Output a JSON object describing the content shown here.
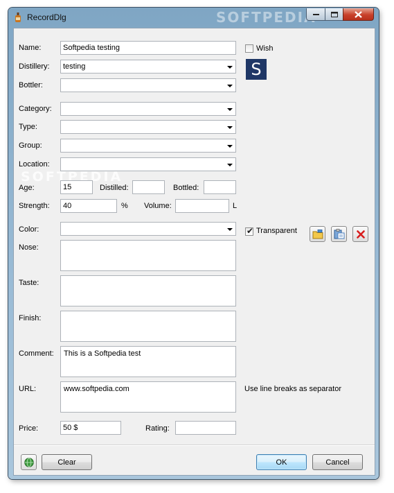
{
  "window": {
    "title": "RecordDlg"
  },
  "watermark": "SOFTPEDIA",
  "fields": {
    "name": {
      "label": "Name:",
      "value": "Softpedia testing"
    },
    "distillery": {
      "label": "Distillery:",
      "value": "testing"
    },
    "bottler": {
      "label": "Bottler:",
      "value": ""
    },
    "category": {
      "label": "Category:",
      "value": ""
    },
    "type": {
      "label": "Type:",
      "value": ""
    },
    "group": {
      "label": "Group:",
      "value": ""
    },
    "location": {
      "label": "Location:",
      "value": ""
    },
    "age": {
      "label": "Age:",
      "value": "15"
    },
    "distilled": {
      "label": "Distilled:",
      "value": ""
    },
    "bottled": {
      "label": "Bottled:",
      "value": ""
    },
    "strength": {
      "label": "Strength:",
      "value": "40",
      "unit": "%"
    },
    "volume": {
      "label": "Volume:",
      "value": "",
      "unit": "L"
    },
    "color": {
      "label": "Color:",
      "value": ""
    },
    "nose": {
      "label": "Nose:",
      "value": ""
    },
    "taste": {
      "label": "Taste:",
      "value": ""
    },
    "finish": {
      "label": "Finish:",
      "value": ""
    },
    "comment": {
      "label": "Comment:",
      "value": "This is a Softpedia test"
    },
    "url": {
      "label": "URL:",
      "value": "www.softpedia.com",
      "hint": "Use line breaks as separator"
    },
    "price": {
      "label": "Price:",
      "value": "50 $"
    },
    "rating": {
      "label": "Rating:",
      "value": ""
    }
  },
  "wish": {
    "label": "Wish",
    "checked": false
  },
  "transparent": {
    "label": "Transparent",
    "checked": true
  },
  "logo_letter": "S",
  "buttons": {
    "clear": "Clear",
    "ok": "OK",
    "cancel": "Cancel"
  },
  "colors": {
    "logo_bg": "#1f3766",
    "delete_red": "#d81e1e",
    "default_button": "#3c7fb1"
  }
}
